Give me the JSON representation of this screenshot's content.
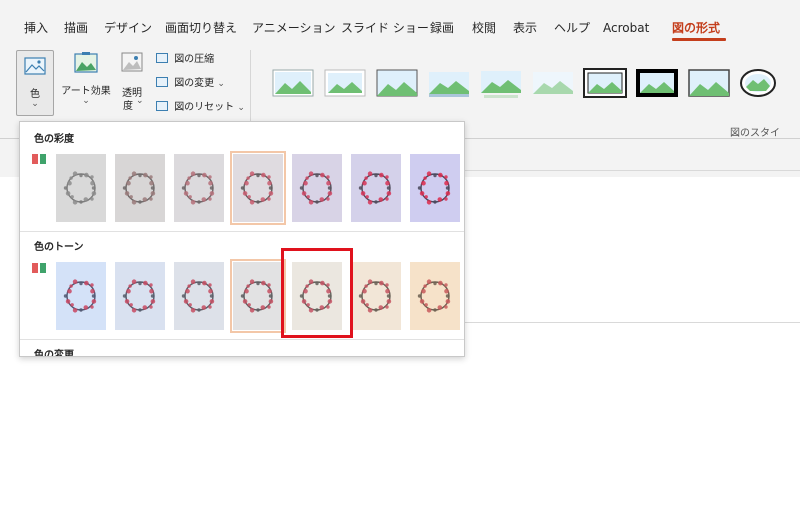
{
  "menu": {
    "items": [
      "挿入",
      "描画",
      "デザイン",
      "画面切り替え",
      "アニメーション",
      "スライド ショー",
      "録画",
      "校閲",
      "表示",
      "ヘルプ",
      "Acrobat"
    ],
    "active": "図の形式"
  },
  "ribbon": {
    "color_label": "色",
    "art_effects_label": "アート効果",
    "transparency_label_1": "透明",
    "transparency_label_2": "度",
    "compress_label": "図の圧縮",
    "change_label": "図の変更",
    "reset_label": "図のリセット",
    "styles_group_label": "図のスタイ"
  },
  "dropdown": {
    "saturation_title": "色の彩度",
    "tone_title": "色のトーン",
    "recolor_title": "色の変更",
    "saturation_swatches": [
      {
        "tint": "#9a9a9a",
        "bg": "#d9d9d9",
        "ring": "#7a7a7a",
        "flower": "#8c8c8c"
      },
      {
        "tint": "#a88c8c",
        "bg": "#d8d6d6",
        "ring": "#6e6a6a",
        "flower": "#9a7a7a"
      },
      {
        "tint": "#b87f84",
        "bg": "#dcdadd",
        "ring": "#6c6466",
        "flower": "#b5707a"
      },
      {
        "tint": "#c86a78",
        "bg": "#dfdbe0",
        "ring": "#5f5a5c",
        "flower": "#c95c6e"
      },
      {
        "tint": "#d0506a",
        "bg": "#d8d3e6",
        "ring": "#554f5b",
        "flower": "#cf4764"
      },
      {
        "tint": "#d83a5c",
        "bg": "#d4d1ea",
        "ring": "#4e4a5a",
        "flower": "#d73457"
      },
      {
        "tint": "#e02a52",
        "bg": "#cfcdf0",
        "ring": "#48475b",
        "flower": "#dd2a4c"
      }
    ],
    "tone_swatches": [
      {
        "tint": "#c14d65",
        "bg": "#d4e2f8",
        "ring": "#4f5670",
        "flower": "#c84561"
      },
      {
        "tint": "#c14d65",
        "bg": "#d9e1f0",
        "ring": "#545a6a",
        "flower": "#c74a63"
      },
      {
        "tint": "#c14d65",
        "bg": "#dde1e9",
        "ring": "#595c66",
        "flower": "#c64d62"
      },
      {
        "tint": "#c14d65",
        "bg": "#e2e2e3",
        "ring": "#5c5c5f",
        "flower": "#c45062"
      },
      {
        "tint": "#c14d65",
        "bg": "#ebe7e0",
        "ring": "#62605a",
        "flower": "#c45264"
      },
      {
        "tint": "#c14d65",
        "bg": "#f2e6d7",
        "ring": "#675f55",
        "flower": "#c65560"
      },
      {
        "tint": "#c14d65",
        "bg": "#f6e2c9",
        "ring": "#6c5f50",
        "flower": "#c85a5c"
      }
    ],
    "selected_saturation": 3,
    "selected_tone": 3,
    "highlighted_tone": 4
  },
  "colors": {
    "accent": "#c43e1c",
    "highlight": "#e0121d"
  }
}
